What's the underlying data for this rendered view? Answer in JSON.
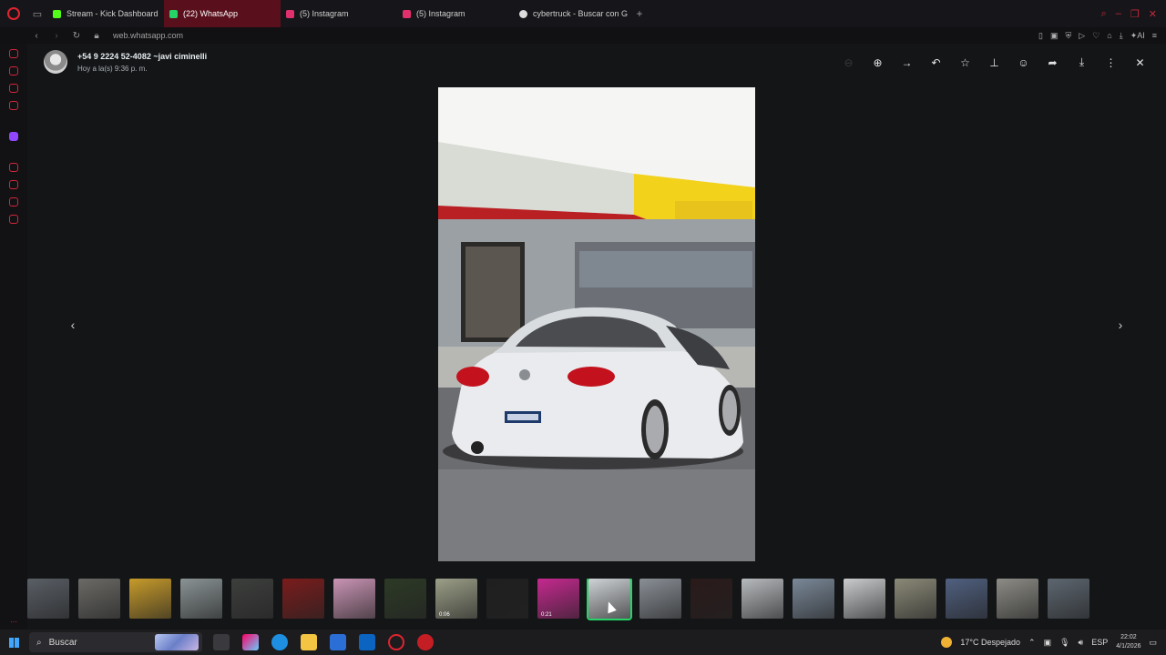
{
  "browser": {
    "tabs": [
      {
        "label": "Stream - Kick Dashboard",
        "favicon_color": "#53fc18",
        "active": false
      },
      {
        "label": "(22) WhatsApp",
        "favicon_color": "#25d366",
        "active": true
      },
      {
        "label": "(5) Instagram",
        "favicon_color": "#e1306c",
        "active": false
      },
      {
        "label": "(5) Instagram",
        "favicon_color": "#e1306c",
        "active": false
      },
      {
        "label": "cybertruck - Buscar con G",
        "favicon_color": "#dddddd",
        "active": false
      }
    ],
    "url": "web.whatsapp.com",
    "accent_color": "#e0242f"
  },
  "viewer": {
    "sender_name": "+54 9 2224 52-4082 ~javi ciminelli",
    "timestamp": "Hoy a la(s) 9:36 p. m.",
    "actions": [
      "zoom-in",
      "forward-arrow",
      "reply",
      "star",
      "pin",
      "emoji",
      "share-forward",
      "download",
      "more-menu",
      "close"
    ],
    "selected_thumb_color": "#25d366",
    "thumbnails": [
      {
        "kind": "image",
        "duration": ""
      },
      {
        "kind": "image",
        "duration": ""
      },
      {
        "kind": "image",
        "duration": ""
      },
      {
        "kind": "image",
        "duration": ""
      },
      {
        "kind": "image",
        "duration": ""
      },
      {
        "kind": "image",
        "duration": ""
      },
      {
        "kind": "image",
        "duration": ""
      },
      {
        "kind": "image",
        "duration": ""
      },
      {
        "kind": "video",
        "duration": "0:06"
      },
      {
        "kind": "image",
        "duration": ""
      },
      {
        "kind": "video",
        "duration": "0:21"
      },
      {
        "kind": "image",
        "duration": "",
        "selected": true
      },
      {
        "kind": "image",
        "duration": ""
      },
      {
        "kind": "image",
        "duration": ""
      },
      {
        "kind": "image",
        "duration": ""
      },
      {
        "kind": "image",
        "duration": ""
      },
      {
        "kind": "image",
        "duration": ""
      },
      {
        "kind": "image",
        "duration": ""
      },
      {
        "kind": "image",
        "duration": ""
      },
      {
        "kind": "image",
        "duration": ""
      },
      {
        "kind": "image",
        "duration": ""
      }
    ]
  },
  "taskbar": {
    "search_label": "Buscar",
    "weather": "17°C  Despejado",
    "language": "ESP",
    "time": "22:02",
    "date": "4/1/2026"
  }
}
